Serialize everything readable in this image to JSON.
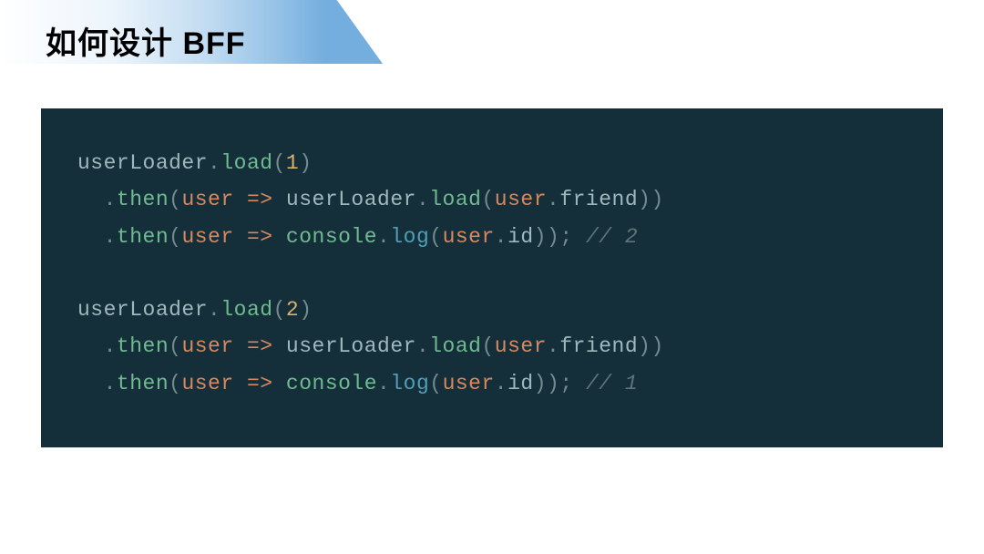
{
  "title": "如何设计 BFF",
  "code": {
    "lines": [
      {
        "tokens": [
          {
            "cls": "tk-ident",
            "t": "userLoader"
          },
          {
            "cls": "tk-punct",
            "t": "."
          },
          {
            "cls": "tk-method",
            "t": "load"
          },
          {
            "cls": "tk-punct",
            "t": "("
          },
          {
            "cls": "tk-num",
            "t": "1"
          },
          {
            "cls": "tk-punct",
            "t": ")"
          }
        ]
      },
      {
        "indent": 1,
        "tokens": [
          {
            "cls": "tk-punct",
            "t": "."
          },
          {
            "cls": "tk-method",
            "t": "then"
          },
          {
            "cls": "tk-punct",
            "t": "("
          },
          {
            "cls": "tk-param",
            "t": "user"
          },
          {
            "cls": "tk-punct",
            "t": " "
          },
          {
            "cls": "tk-arrow",
            "t": "=>"
          },
          {
            "cls": "tk-punct",
            "t": " "
          },
          {
            "cls": "tk-ident",
            "t": "userLoader"
          },
          {
            "cls": "tk-punct",
            "t": "."
          },
          {
            "cls": "tk-method",
            "t": "load"
          },
          {
            "cls": "tk-punct",
            "t": "("
          },
          {
            "cls": "tk-param",
            "t": "user"
          },
          {
            "cls": "tk-punct",
            "t": "."
          },
          {
            "cls": "tk-ident",
            "t": "friend"
          },
          {
            "cls": "tk-punct",
            "t": "))"
          }
        ]
      },
      {
        "indent": 1,
        "tokens": [
          {
            "cls": "tk-punct",
            "t": "."
          },
          {
            "cls": "tk-method",
            "t": "then"
          },
          {
            "cls": "tk-punct",
            "t": "("
          },
          {
            "cls": "tk-param",
            "t": "user"
          },
          {
            "cls": "tk-punct",
            "t": " "
          },
          {
            "cls": "tk-arrow",
            "t": "=>"
          },
          {
            "cls": "tk-punct",
            "t": " "
          },
          {
            "cls": "tk-obj",
            "t": "console"
          },
          {
            "cls": "tk-punct",
            "t": "."
          },
          {
            "cls": "tk-prop",
            "t": "log"
          },
          {
            "cls": "tk-punct",
            "t": "("
          },
          {
            "cls": "tk-param",
            "t": "user"
          },
          {
            "cls": "tk-punct",
            "t": "."
          },
          {
            "cls": "tk-ident",
            "t": "id"
          },
          {
            "cls": "tk-punct",
            "t": ")); "
          },
          {
            "cls": "tk-comment",
            "t": "// 2"
          }
        ]
      },
      {
        "tokens": []
      },
      {
        "tokens": [
          {
            "cls": "tk-ident",
            "t": "userLoader"
          },
          {
            "cls": "tk-punct",
            "t": "."
          },
          {
            "cls": "tk-method",
            "t": "load"
          },
          {
            "cls": "tk-punct",
            "t": "("
          },
          {
            "cls": "tk-num",
            "t": "2"
          },
          {
            "cls": "tk-punct",
            "t": ")"
          }
        ]
      },
      {
        "indent": 1,
        "tokens": [
          {
            "cls": "tk-punct",
            "t": "."
          },
          {
            "cls": "tk-method",
            "t": "then"
          },
          {
            "cls": "tk-punct",
            "t": "("
          },
          {
            "cls": "tk-param",
            "t": "user"
          },
          {
            "cls": "tk-punct",
            "t": " "
          },
          {
            "cls": "tk-arrow",
            "t": "=>"
          },
          {
            "cls": "tk-punct",
            "t": " "
          },
          {
            "cls": "tk-ident",
            "t": "userLoader"
          },
          {
            "cls": "tk-punct",
            "t": "."
          },
          {
            "cls": "tk-method",
            "t": "load"
          },
          {
            "cls": "tk-punct",
            "t": "("
          },
          {
            "cls": "tk-param",
            "t": "user"
          },
          {
            "cls": "tk-punct",
            "t": "."
          },
          {
            "cls": "tk-ident",
            "t": "friend"
          },
          {
            "cls": "tk-punct",
            "t": "))"
          }
        ]
      },
      {
        "indent": 1,
        "tokens": [
          {
            "cls": "tk-punct",
            "t": "."
          },
          {
            "cls": "tk-method",
            "t": "then"
          },
          {
            "cls": "tk-punct",
            "t": "("
          },
          {
            "cls": "tk-param",
            "t": "user"
          },
          {
            "cls": "tk-punct",
            "t": " "
          },
          {
            "cls": "tk-arrow",
            "t": "=>"
          },
          {
            "cls": "tk-punct",
            "t": " "
          },
          {
            "cls": "tk-obj",
            "t": "console"
          },
          {
            "cls": "tk-punct",
            "t": "."
          },
          {
            "cls": "tk-prop",
            "t": "log"
          },
          {
            "cls": "tk-punct",
            "t": "("
          },
          {
            "cls": "tk-param",
            "t": "user"
          },
          {
            "cls": "tk-punct",
            "t": "."
          },
          {
            "cls": "tk-ident",
            "t": "id"
          },
          {
            "cls": "tk-punct",
            "t": ")); "
          },
          {
            "cls": "tk-comment",
            "t": "// 1"
          }
        ]
      }
    ]
  }
}
